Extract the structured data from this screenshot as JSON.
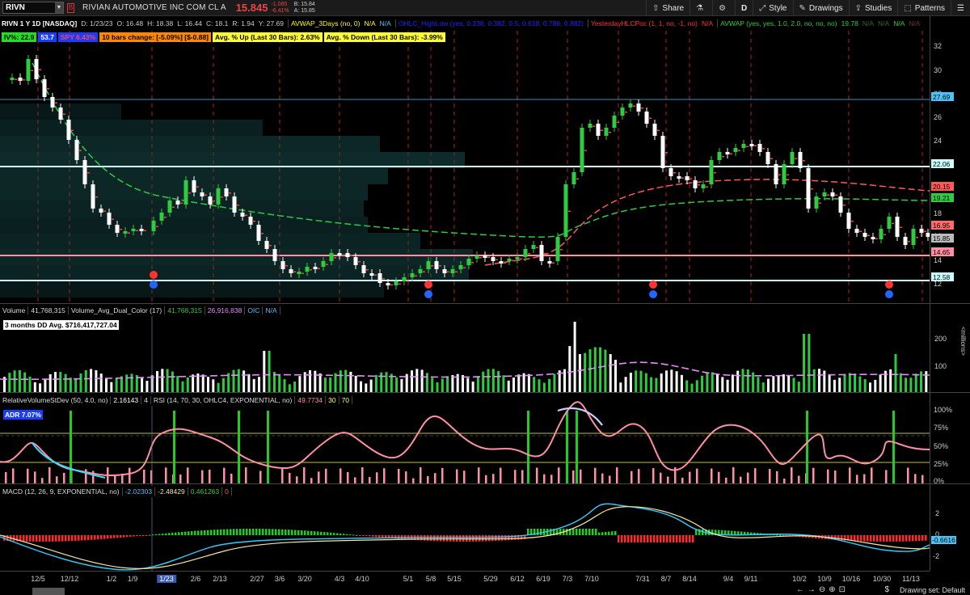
{
  "header": {
    "symbol": "RIVN",
    "company": "RIVIAN AUTOMOTIVE INC COM CL A",
    "last": "15.845",
    "change": "-1.085",
    "change_pct": "-6.41%",
    "bid": "B: 15.84",
    "ask": "A: 15.85",
    "buttons": {
      "share": "Share",
      "style": "Style",
      "drawings": "Drawings",
      "studies": "Studies",
      "patterns": "Patterns",
      "period": "D"
    }
  },
  "studybar": {
    "title": "RIVN 1 Y 1D [NASDAQ]",
    "date": "D: 1/23/23",
    "open": "O: 16.48",
    "high": "H: 18.38",
    "low": "L: 16.44",
    "close": "C: 18.1",
    "range": "R: 1.94",
    "y": "Y: 27.69",
    "avwap3": "AVWAP_3Days (no, 0)",
    "na1": "N/A",
    "na2": "N/A",
    "ohlc": "OHLC_HighLow (yes, 0.236, 0.382, 0.5, 0.618, 0.786, 0.882)",
    "yest": "YesterdayHLCPoc (1, 1, no, -1, no)",
    "na3": "N/A",
    "avwap": "AVWAP (yes, yes, 1.0, 2.0, no, no, no)",
    "avwap_val": "19.78",
    "na4": "N/A",
    "na5": "N/A",
    "na6": "N/A",
    "na7": "N/A"
  },
  "labels": {
    "iv": "IV%: 22.9",
    "t1": "53.7",
    "t2": "SPY 6.43%",
    "bars10": "10 bars change: [-5.09%] [$-0.88]",
    "avgup": "Avg. % Up (Last 30 Bars): 2.63%",
    "avgdown": "Avg. % Down (Last 30 Bars): -3.99%"
  },
  "price_axis": {
    "ticks": [
      "32",
      "30",
      "28",
      "26",
      "24",
      "22",
      "20",
      "18",
      "16",
      "14",
      "12"
    ],
    "tags": [
      {
        "text": "27.69",
        "color": "#4fc3f7"
      },
      {
        "text": "22.06",
        "color": "#ccffff"
      },
      {
        "text": "20.15",
        "color": "#ff5a5a"
      },
      {
        "text": "19.21",
        "color": "#2ecc40"
      },
      {
        "text": "16.95",
        "color": "#ff6b6b"
      },
      {
        "text": "15.85",
        "color": "#bbbbbb"
      },
      {
        "text": "14.65",
        "color": "#ff8fa3"
      },
      {
        "text": "12.58",
        "color": "#ccffff"
      }
    ]
  },
  "volume": {
    "title": "Volume",
    "value": "41,768,315",
    "avg_title": "Volume_Avg_Dual_Color (17)",
    "avg1": "41,768,315",
    "avg2": "26,916,838",
    "oic": "OIC",
    "na": "N/A",
    "dd_avg": "3 months DD Avg. $716,417,727.04",
    "ticks": [
      "200",
      "100"
    ],
    "unit": "<millions>"
  },
  "rsi": {
    "title1": "RelativeVolumeStDev (50, 4.0, no)",
    "v1": "2.16143",
    "v1b": "4",
    "title2": "RSI (14, 70, 30, OHLC4, EXPONENTIAL, no)",
    "v2": "49.7734",
    "ob": "30",
    "os": "70",
    "adr": "ADR 7.07%",
    "ticks": [
      "100%",
      "75%",
      "50%",
      "25%",
      "0%"
    ]
  },
  "macd": {
    "title": "MACD (12, 26, 9, EXPONENTIAL, no)",
    "v1": "-2.02303",
    "v2": "-2.48429",
    "v3": "0.461263",
    "v4": "0",
    "ticks": [
      "2",
      "0",
      "-2"
    ],
    "tag": "-0.6616"
  },
  "xaxis": {
    "labels": [
      "12/5",
      "12/12",
      "1/2",
      "1/9",
      "1/23",
      "2/6",
      "2/13",
      "2/27",
      "3/6",
      "3/20",
      "4/3",
      "4/10",
      "5/1",
      "5/8",
      "5/15",
      "5/29",
      "6/12",
      "6/19",
      "7/3",
      "7/10",
      "7/31",
      "8/7",
      "8/14",
      "9/4",
      "9/11",
      "10/2",
      "10/9",
      "10/16",
      "10/30",
      "11/13"
    ],
    "highlight": "1/23"
  },
  "footer": {
    "drawing_set": "Drawing set: Default",
    "dollar": "$"
  },
  "colors": {
    "accent": "#3a5bb5",
    "up": "#2ecc40",
    "down": "#ffffff",
    "red": "#ff3b3b",
    "teal": "#1f4e4e"
  }
}
